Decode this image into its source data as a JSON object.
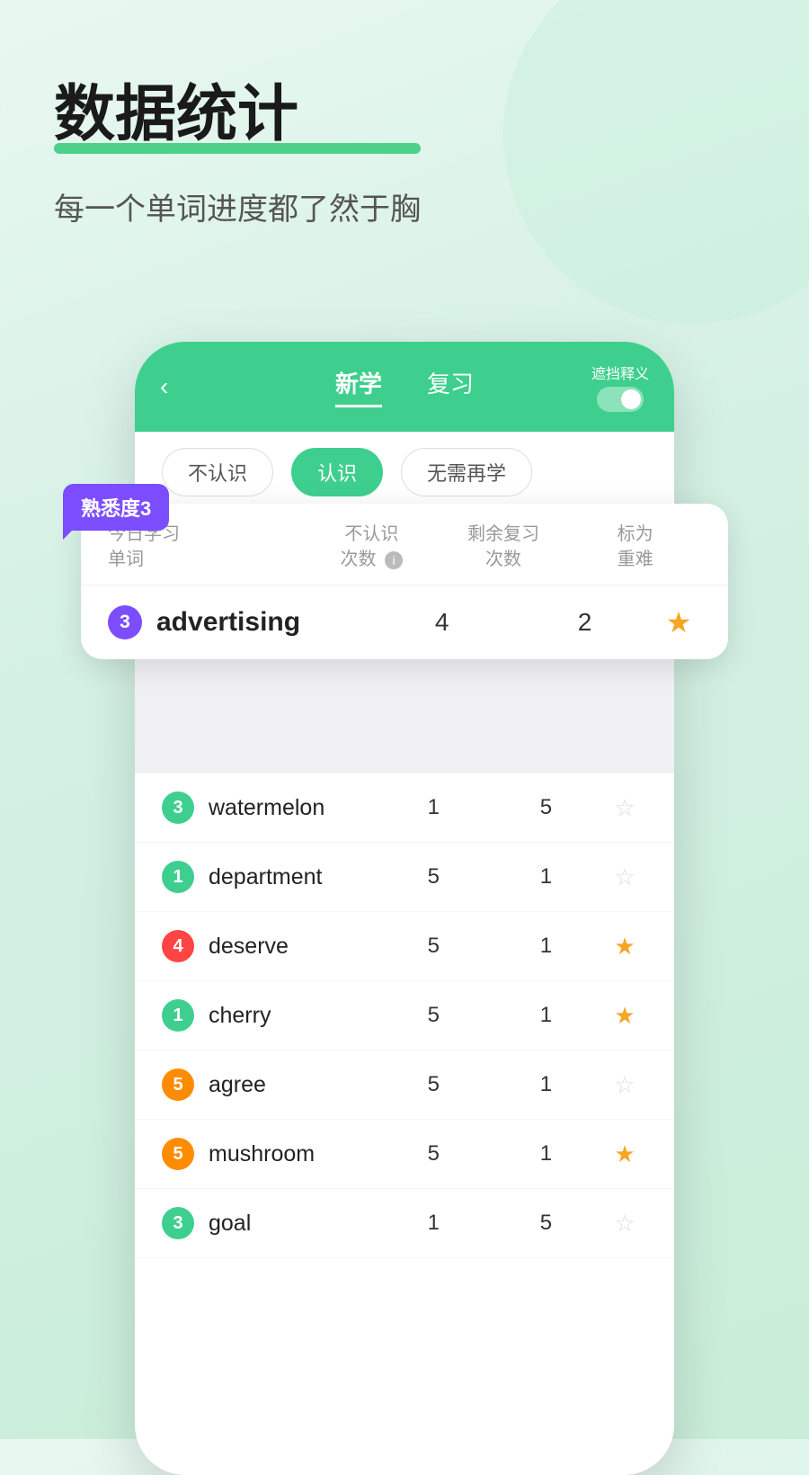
{
  "background": {
    "color": "#e2f5eb"
  },
  "header": {
    "title": "数据统计",
    "subtitle": "每一个单词进度都了然于胸"
  },
  "phone": {
    "top_bar": {
      "back_label": "‹",
      "tab_new": "新学",
      "tab_review": "复习",
      "toggle_label": "遮挡释义",
      "active_tab": "新学"
    },
    "filters": [
      {
        "label": "不认识",
        "active": false
      },
      {
        "label": "认识",
        "active": true
      },
      {
        "label": "无需再学",
        "active": false
      }
    ],
    "stats_table": {
      "col_today": "今日学习\n单词",
      "col_unrecognized": "不认识\n次数",
      "col_remaining": "剩余复习\n次数",
      "col_mark": "标为\n重难"
    },
    "familiarity_label": "熟悉度3",
    "highlighted_word": {
      "level": "3",
      "level_color": "purple",
      "word": "advertising",
      "unrecognized": "4",
      "remaining": "2",
      "starred": true
    },
    "word_list": [
      {
        "level": "3",
        "level_color": "green",
        "word": "watermelon",
        "unrecognized": "1",
        "remaining": "5",
        "starred": false
      },
      {
        "level": "1",
        "level_color": "green",
        "word": "department",
        "unrecognized": "5",
        "remaining": "1",
        "starred": false
      },
      {
        "level": "4",
        "level_color": "red",
        "word": "deserve",
        "unrecognized": "5",
        "remaining": "1",
        "starred": true
      },
      {
        "level": "1",
        "level_color": "green",
        "word": "cherry",
        "unrecognized": "5",
        "remaining": "1",
        "starred": true
      },
      {
        "level": "5",
        "level_color": "orange",
        "word": "agree",
        "unrecognized": "5",
        "remaining": "1",
        "starred": false
      },
      {
        "level": "5",
        "level_color": "orange",
        "word": "mushroom",
        "unrecognized": "5",
        "remaining": "1",
        "starred": true
      },
      {
        "level": "3",
        "level_color": "green",
        "word": "goal",
        "unrecognized": "1",
        "remaining": "5",
        "starred": false
      }
    ]
  }
}
